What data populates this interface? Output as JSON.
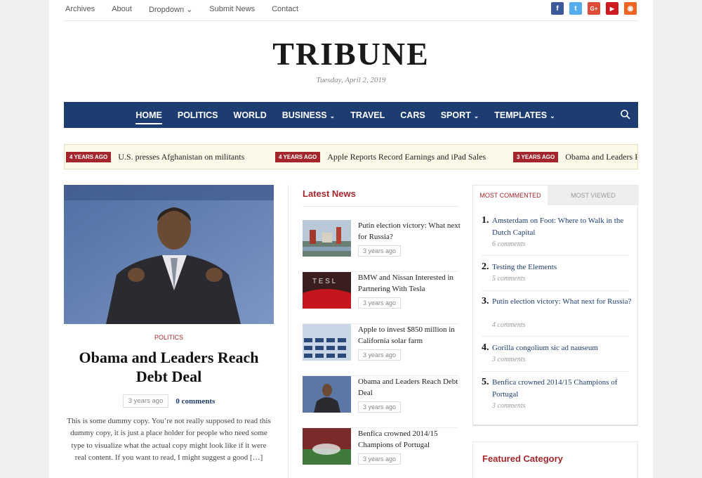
{
  "topbar": {
    "links": [
      "Archives",
      "About",
      "Dropdown",
      "Submit News",
      "Contact"
    ],
    "social": [
      {
        "icon": "facebook-icon",
        "glyph": "f",
        "color": "#3b5998"
      },
      {
        "icon": "twitter-icon",
        "glyph": "t",
        "color": "#55acee"
      },
      {
        "icon": "google-plus-icon",
        "glyph": "G+",
        "color": "#dd4b39"
      },
      {
        "icon": "youtube-icon",
        "glyph": "▶",
        "color": "#cc181e"
      },
      {
        "icon": "rss-icon",
        "glyph": "◉",
        "color": "#f26522"
      }
    ]
  },
  "masthead": {
    "logo": "TRIBUNE",
    "date": "Tuesday, April 2, 2019"
  },
  "nav": {
    "items": [
      "HOME",
      "POLITICS",
      "WORLD",
      "BUSINESS",
      "TRAVEL",
      "CARS",
      "SPORT",
      "TEMPLATES"
    ],
    "bg_color": "#1d3d72"
  },
  "ticker": [
    {
      "badge": "4 YEARS AGO",
      "text": "U.S. presses Afghanistan on militants"
    },
    {
      "badge": "4 YEARS AGO",
      "text": "Apple Reports Record Earnings and iPad Sales"
    },
    {
      "badge": "3 YEARS AGO",
      "text": "Obama and Leaders Reach Debt Deal"
    }
  ],
  "featured": {
    "category": "POLITICS",
    "title": "Obama and Leaders Reach Debt Deal",
    "ago": "3 years ago",
    "comments": "0 comments",
    "excerpt": "This is some dummy copy. You’re not really supposed to read this dummy copy, it is just a place holder for people who need some type to visualize what the actual copy might look like if it were real content. If you want to read, I might suggest a good […]"
  },
  "latest_news": {
    "title": "Latest News",
    "items": [
      {
        "title": "Putin election victory: What next for Russia?",
        "ago": "3 years ago"
      },
      {
        "title": "BMW and Nissan Interested in Partnering With Tesla",
        "ago": "3 years ago"
      },
      {
        "title": "Apple to invest $850 million in California solar farm",
        "ago": "3 years ago"
      },
      {
        "title": "Obama and Leaders Reach Debt Deal",
        "ago": "3 years ago"
      },
      {
        "title": "Benfica crowned 2014/15 Champions of Portugal",
        "ago": "3 years ago"
      }
    ]
  },
  "sidebar": {
    "tab_active": "MOST COMMENTED",
    "tab_inactive": "MOST VIEWED",
    "items": [
      {
        "num": "1.",
        "title": "Amsterdam on Foot: Where to Walk in the Dutch Capital",
        "count": "6 comments"
      },
      {
        "num": "2.",
        "title": "Testing the Elements",
        "count": "5 comments"
      },
      {
        "num": "3.",
        "title": "Putin election victory: What next for Russia?",
        "count": "4 comments"
      },
      {
        "num": "4.",
        "title": "Gorilla congolium sic ad nauseum",
        "count": "3 comments"
      },
      {
        "num": "5.",
        "title": "Benfica crowned 2014/15 Champions of Portugal",
        "count": "3 comments"
      }
    ],
    "featured_category_title": "Featured Category"
  },
  "colors": {
    "accent": "#a4262c",
    "navy": "#1d3d72"
  }
}
